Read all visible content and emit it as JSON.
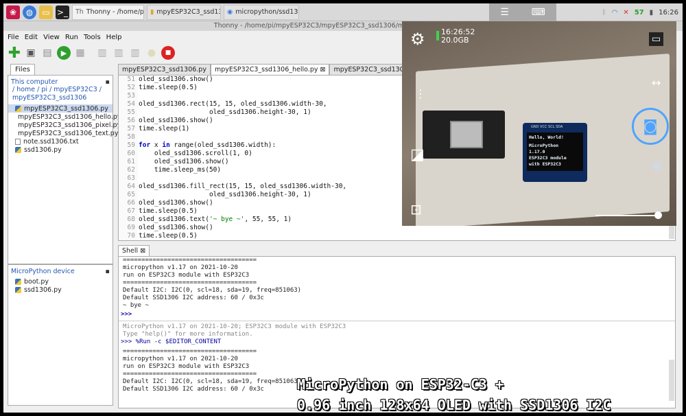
{
  "taskbar": {
    "tasks": [
      {
        "label": "Thonny  -  /home/pi/..."
      },
      {
        "label": "mpyESP32C3_ssd13..."
      },
      {
        "label": "micropython/ssd130..."
      }
    ],
    "battery": "57",
    "clock": "16:26"
  },
  "window": {
    "title": "Thonny  -  /home/pi/mpyESP32C3/mpyESP32C3_ssd1306/mpyESP32C3_ssd1306"
  },
  "menu": [
    "File",
    "Edit",
    "View",
    "Run",
    "Tools",
    "Help"
  ],
  "files": {
    "tab_label": "Files",
    "this_computer_label": "This computer",
    "path_lines": [
      "/ home / pi / mpyESP32C3 /",
      "mpyESP32C3_ssd1306"
    ],
    "local_files": [
      {
        "name": "mpyESP32C3_ssd1306.py",
        "type": "py"
      },
      {
        "name": "mpyESP32C3_ssd1306_hello.py",
        "type": "py"
      },
      {
        "name": "mpyESP32C3_ssd1306_pixel.py",
        "type": "py"
      },
      {
        "name": "mpyESP32C3_ssd1306_text.py",
        "type": "py"
      },
      {
        "name": "note.ssd1306.txt",
        "type": "txt"
      },
      {
        "name": "ssd1306.py",
        "type": "py"
      }
    ],
    "device_label": "MicroPython device",
    "device_files": [
      {
        "name": "boot.py"
      },
      {
        "name": "ssd1306.py"
      }
    ]
  },
  "editor": {
    "tabs": [
      {
        "label": "mpyESP32C3_ssd1306.py"
      },
      {
        "label": "mpyESP32C3_ssd1306_hello.py ⊠"
      },
      {
        "label": "mpyESP32C3_ssd1306_pixel.py"
      },
      {
        "label": "mp"
      }
    ],
    "lines": [
      {
        "n": "51",
        "text": "oled_ssd1306.show()"
      },
      {
        "n": "52",
        "text": "time.sleep(0.5)"
      },
      {
        "n": "53",
        "text": ""
      },
      {
        "n": "54",
        "text": "oled_ssd1306.rect(15, 15, oled_ssd1306.width-30,"
      },
      {
        "n": "55",
        "text": "                  oled_ssd1306.height-30, 1)"
      },
      {
        "n": "56",
        "text": "oled_ssd1306.show()"
      },
      {
        "n": "57",
        "text": "time.sleep(1)"
      },
      {
        "n": "58",
        "text": ""
      },
      {
        "n": "59",
        "text": "for x in range(oled_ssd1306.width):"
      },
      {
        "n": "60",
        "text": "    oled_ssd1306.scroll(1, 0)"
      },
      {
        "n": "61",
        "text": "    oled_ssd1306.show()"
      },
      {
        "n": "62",
        "text": "    time.sleep_ms(50)"
      },
      {
        "n": "63",
        "text": ""
      },
      {
        "n": "64",
        "text": "oled_ssd1306.fill_rect(15, 15, oled_ssd1306.width-30,"
      },
      {
        "n": "65",
        "text": "                  oled_ssd1306.height-30, 1)"
      },
      {
        "n": "66",
        "text": "oled_ssd1306.show()"
      },
      {
        "n": "67",
        "text": "time.sleep(0.5)"
      },
      {
        "n": "68",
        "text": "oled_ssd1306.text('~ bye ~', 55, 55, 1)"
      },
      {
        "n": "69",
        "text": "oled_ssd1306.show()"
      },
      {
        "n": "70",
        "text": "time.sleep(0.5)"
      }
    ]
  },
  "shell": {
    "tab_label": "Shell ⊠",
    "block1": [
      "====================================",
      "micropython v1.17 on 2021-10-20",
      "run on ESP32C3 module with ESP32C3",
      "====================================",
      "Default I2C: I2C(0, scl=18, sda=19, freq=851063)",
      "Default SSD1306 I2C address: 60 / 0x3c",
      "~ bye ~"
    ],
    "prompt1": ">>>",
    "banner": [
      "MicroPython v1.17 on 2021-10-20; ESP32C3 module with ESP32C3",
      "Type \"help()\" for more information."
    ],
    "prompt2": ">>> %Run -c $EDITOR_CONTENT",
    "block2": [
      "====================================",
      "micropython v1.17 on 2021-10-20",
      "run on ESP32C3 module with ESP32C3",
      "====================================",
      "Default I2C: I2C(0, scl=18, sda=19, freq=851063)",
      "Default SSD1306 I2C address: 60 / 0x3c"
    ]
  },
  "camera": {
    "time": "16:26:52",
    "storage": "20.0GB",
    "oled_lines": [
      "Hello, World!",
      "",
      "MicroPython",
      "1.17.0",
      "ESP32C3 module",
      "with ESP32C3"
    ],
    "header_label": "GND VCC SCL SDA"
  },
  "caption": {
    "line1": "MicroPython on ESP32-C3 +",
    "line2": "0.96 inch 128x64 OLED with SSD1306 I2C"
  }
}
